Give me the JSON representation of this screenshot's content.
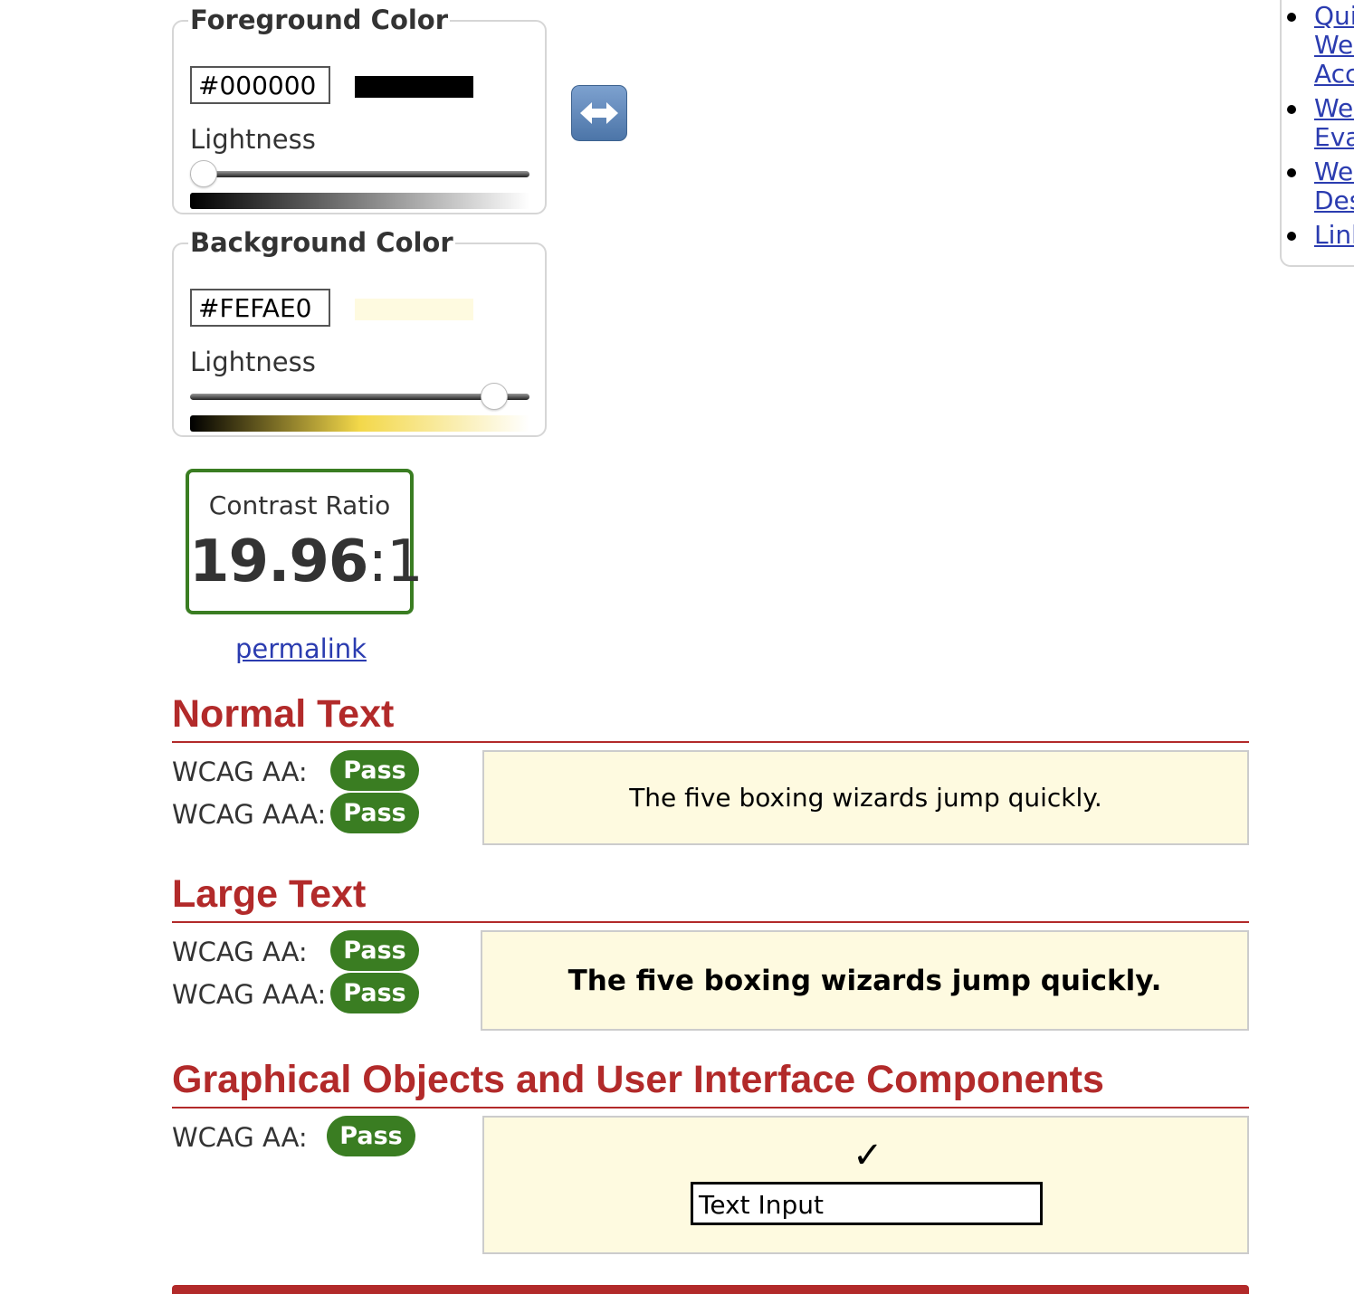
{
  "foreground": {
    "legend": "Foreground Color",
    "hex_value": "#000000",
    "swatch_color": "#000000",
    "lightness_label": "Lightness",
    "lightness_level": 0.0,
    "gradient_colors": [
      "#000000",
      "#ffffff"
    ]
  },
  "background": {
    "legend": "Background Color",
    "hex_value": "#FEFAE0",
    "swatch_color": "#FEFAE0",
    "lightness_label": "Lightness",
    "lightness_level": 0.93,
    "gradient_colors": [
      "#000000",
      "#f3d84a",
      "#ffffff"
    ]
  },
  "swap": {
    "icon": "left-right-arrow-icon"
  },
  "contrast": {
    "label": "Contrast Ratio",
    "ratio_main": "19.96",
    "ratio_suffix": ":1",
    "border_color": "#3a7d22"
  },
  "permalink": "permalink",
  "sections": {
    "normal": {
      "title": "Normal Text",
      "aa_label": "WCAG AA:",
      "aa_result": "Pass",
      "aaa_label": "WCAG AAA:",
      "aaa_result": "Pass",
      "sample": "The five boxing wizards jump quickly."
    },
    "large": {
      "title": "Large Text",
      "aa_label": "WCAG AA:",
      "aa_result": "Pass",
      "aaa_label": "WCAG AAA:",
      "aaa_result": "Pass",
      "sample": "The five boxing wizards jump quickly."
    },
    "graphical": {
      "title": "Graphical Objects and User Interface Components",
      "aa_label": "WCAG AA:",
      "aa_result": "Pass",
      "check_glyph": "✓",
      "input_value": "Text Input"
    }
  },
  "sidebar": {
    "items": [
      {
        "lines": [
          "Quic",
          "Web",
          "Acce"
        ]
      },
      {
        "lines": [
          "Web",
          "Eval"
        ]
      },
      {
        "lines": [
          "Web",
          "Des"
        ]
      },
      {
        "lines": [
          "Link"
        ]
      }
    ]
  },
  "colors": {
    "heading": "#b22a2a",
    "pass": "#3a7d22",
    "link": "#2b3cb0",
    "preview_bg": "#FEFAE0"
  }
}
